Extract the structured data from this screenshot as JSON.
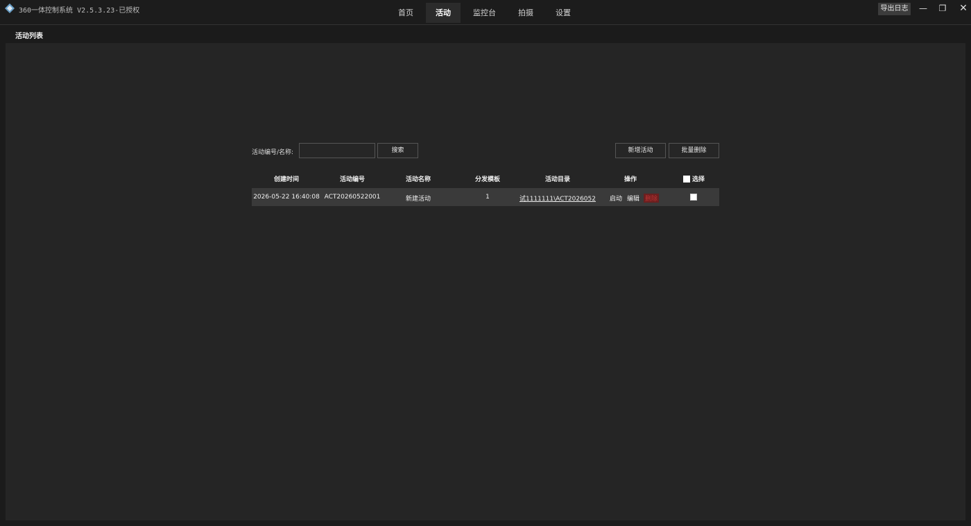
{
  "app": {
    "title": "360一体控制系统 V2.5.3.23-已授权",
    "export_log": "导出日志"
  },
  "nav": [
    {
      "label": "首页"
    },
    {
      "label": "活动",
      "active": true
    },
    {
      "label": "监控台"
    },
    {
      "label": "拍摄"
    },
    {
      "label": "设置"
    }
  ],
  "section": {
    "title": "活动列表"
  },
  "toolbar": {
    "search_label": "活动编号/名称:",
    "search_value": "",
    "search_button": "搜索",
    "new_button": "新增活动",
    "batch_delete_button": "批量删除"
  },
  "table": {
    "headers": {
      "created": "创建时间",
      "code": "活动编号",
      "name": "活动名称",
      "template": "分发模板",
      "dir": "活动目录",
      "ops": "操作",
      "select": "选择"
    },
    "rows": [
      {
        "created": "2026-05-22 16:40:08",
        "code": "ACT20260522001",
        "name": "新建活动",
        "template": "1",
        "dir": "试1111111\\ACT2026052",
        "op_start": "启动",
        "op_edit": "编辑",
        "op_delete": "删除"
      }
    ]
  },
  "colors": {
    "accent_delete": "#b33333"
  }
}
